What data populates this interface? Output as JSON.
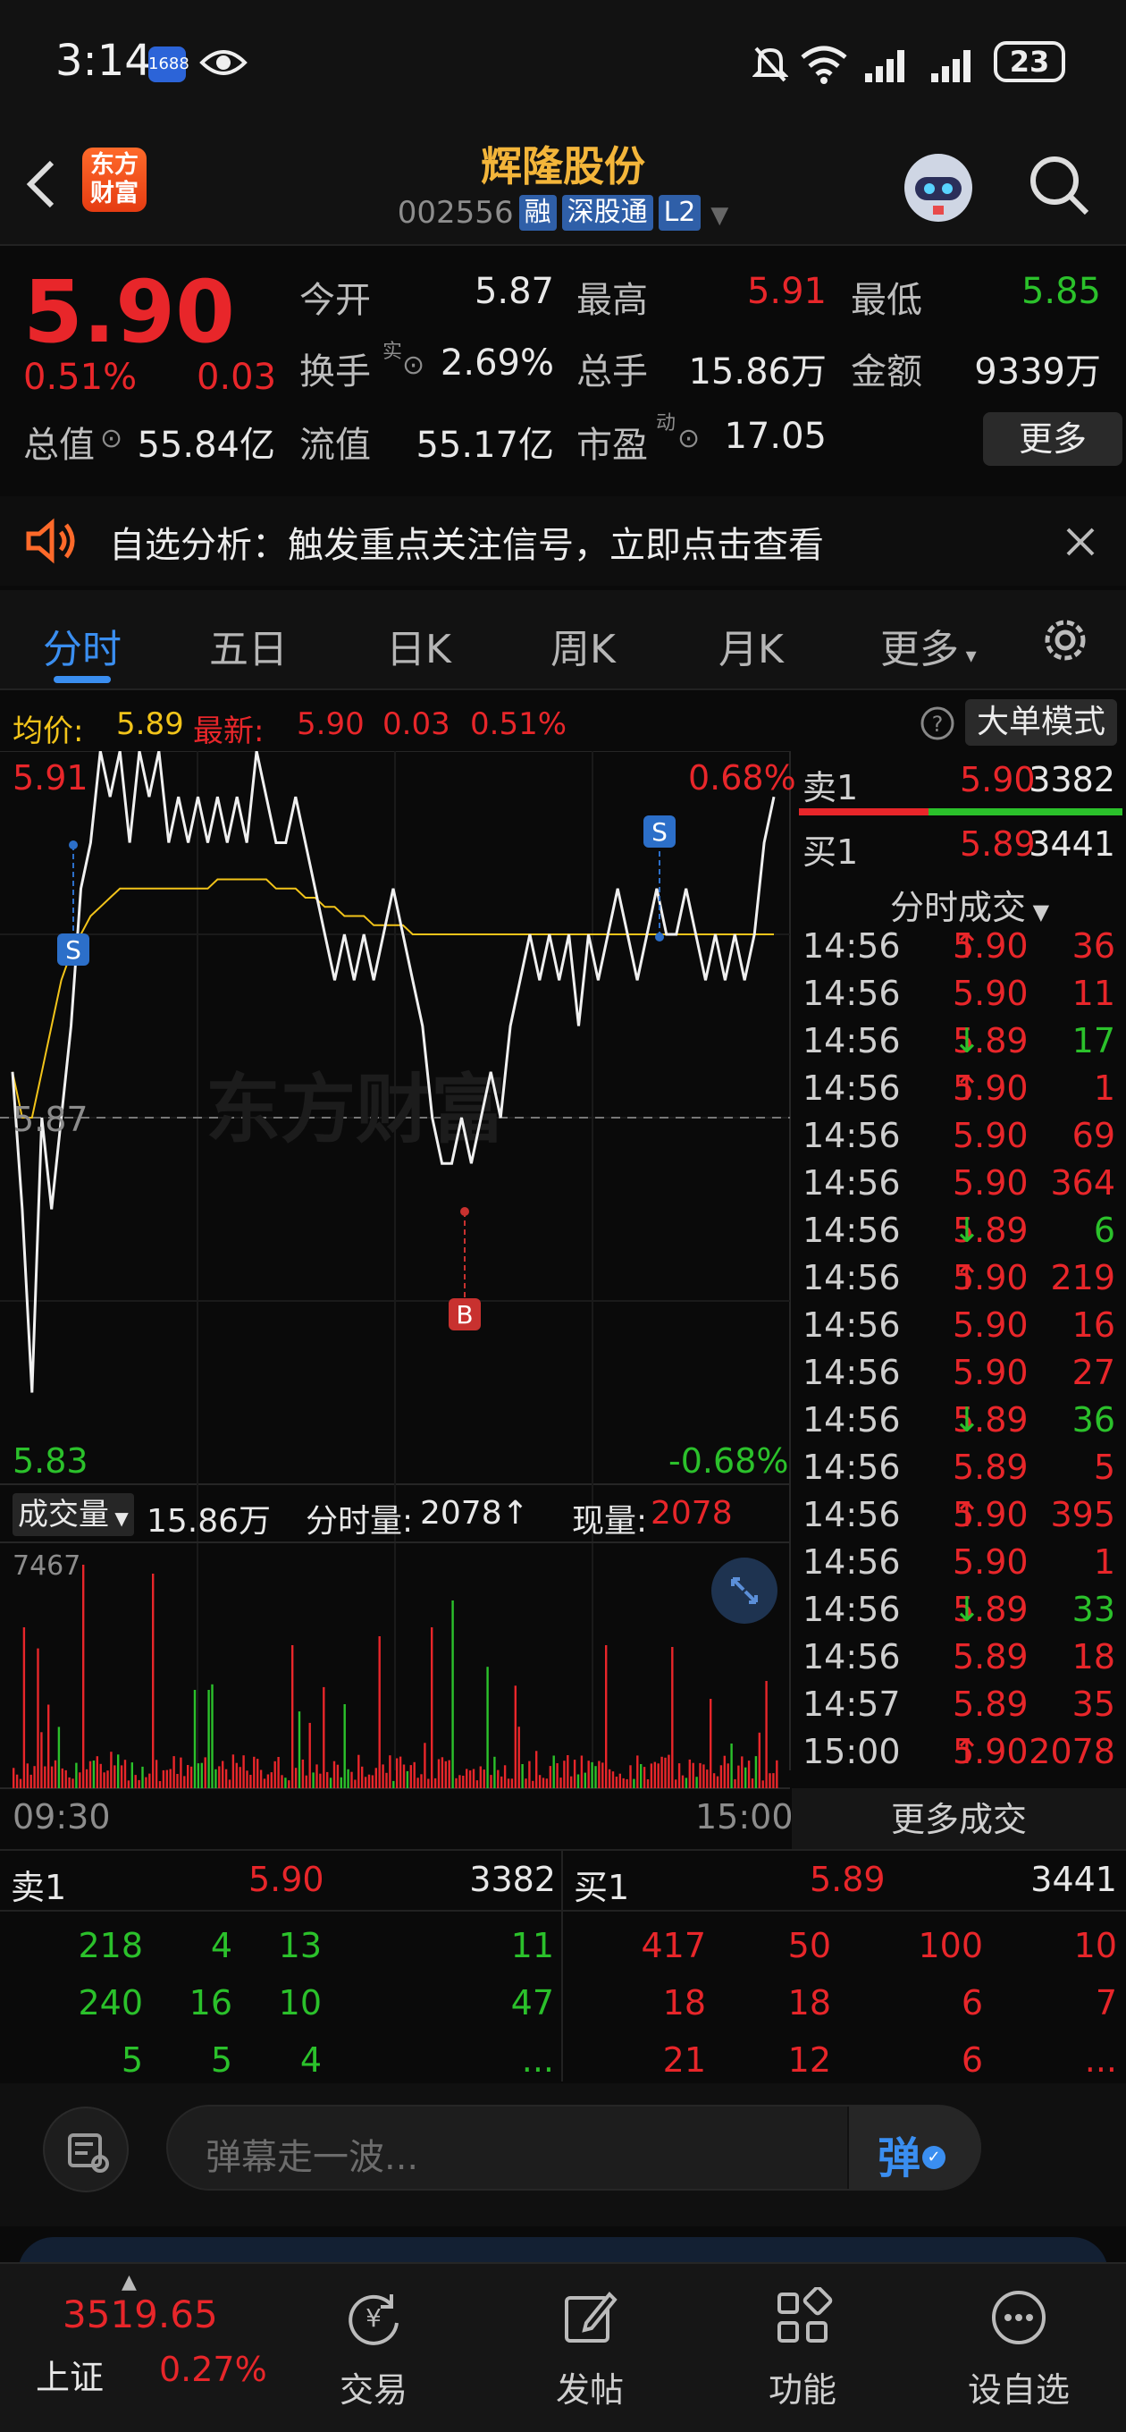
{
  "status_bar": {
    "time": "3:14",
    "app_badge": "1688",
    "battery": "23"
  },
  "header": {
    "logo_line1": "东方",
    "logo_line2": "财富",
    "stock_name": "辉隆股份",
    "stock_code": "002556",
    "tags": [
      "融",
      "深股通",
      "L2"
    ]
  },
  "quote": {
    "price": "5.90",
    "change_pct": "0.51%",
    "change": "0.03",
    "open_label": "今开",
    "open": "5.87",
    "high_label": "最高",
    "high": "5.91",
    "low_label": "最低",
    "low": "5.85",
    "turnover_label": "换手",
    "turnover_sup": "实",
    "turnover": "2.69%",
    "vol_label": "总手",
    "vol": "15.86万",
    "amount_label": "金额",
    "amount": "9339万",
    "mktcap_label": "总值",
    "mktcap": "55.84亿",
    "float_label": "流值",
    "float": "55.17亿",
    "pe_label": "市盈",
    "pe_sup": "动",
    "pe": "17.05",
    "more_label": "更多"
  },
  "alert": {
    "text": "自选分析：触发重点关注信号，立即点击查看"
  },
  "tabs": [
    "分时",
    "五日",
    "日K",
    "周K",
    "月K",
    "更多"
  ],
  "infoline": {
    "avg_label": "均价:",
    "avg": "5.89",
    "latest_label": "最新:",
    "latest": "5.90",
    "latest_change": "0.03",
    "latest_pct": "0.51%",
    "big_order_label": "大单模式"
  },
  "chart_labels": {
    "top_price": "5.91",
    "top_pct": "0.68%",
    "mid_price": "5.87",
    "bottom_price": "5.83",
    "bottom_pct": "-0.68%",
    "marker_s": "S",
    "marker_b": "B",
    "watermark": "东方财富"
  },
  "volume": {
    "label": "成交量",
    "total": "15.86万",
    "minute_label": "分时量:",
    "minute": "2078",
    "current_label": "现量:",
    "current": "2078",
    "max_tick": "7467",
    "time_start": "09:30",
    "time_end": "15:00"
  },
  "tape": {
    "sell1_label": "卖1",
    "sell1_price": "5.90",
    "sell1_vol": "3382",
    "buy1_label": "买1",
    "buy1_price": "5.89",
    "buy1_vol": "3441",
    "title": "分时成交",
    "more_label": "更多成交",
    "rows": [
      {
        "time": "14:56",
        "price": "5.90",
        "arrow": "↑",
        "vol": "36",
        "dir": "up"
      },
      {
        "time": "14:56",
        "price": "5.90",
        "arrow": "",
        "vol": "11",
        "dir": "up"
      },
      {
        "time": "14:56",
        "price": "5.89",
        "arrow": "↓",
        "vol": "17",
        "dir": "down"
      },
      {
        "time": "14:56",
        "price": "5.90",
        "arrow": "↑",
        "vol": "1",
        "dir": "up"
      },
      {
        "time": "14:56",
        "price": "5.90",
        "arrow": "",
        "vol": "69",
        "dir": "up"
      },
      {
        "time": "14:56",
        "price": "5.90",
        "arrow": "",
        "vol": "364",
        "dir": "up"
      },
      {
        "time": "14:56",
        "price": "5.89",
        "arrow": "↓",
        "vol": "6",
        "dir": "down"
      },
      {
        "time": "14:56",
        "price": "5.90",
        "arrow": "↑",
        "vol": "219",
        "dir": "up"
      },
      {
        "time": "14:56",
        "price": "5.90",
        "arrow": "",
        "vol": "16",
        "dir": "up"
      },
      {
        "time": "14:56",
        "price": "5.90",
        "arrow": "",
        "vol": "27",
        "dir": "up"
      },
      {
        "time": "14:56",
        "price": "5.89",
        "arrow": "↓",
        "vol": "36",
        "dir": "down"
      },
      {
        "time": "14:56",
        "price": "5.89",
        "arrow": "",
        "vol": "5",
        "dir": "up"
      },
      {
        "time": "14:56",
        "price": "5.90",
        "arrow": "↑",
        "vol": "395",
        "dir": "up"
      },
      {
        "time": "14:56",
        "price": "5.90",
        "arrow": "",
        "vol": "1",
        "dir": "up"
      },
      {
        "time": "14:56",
        "price": "5.89",
        "arrow": "↓",
        "vol": "33",
        "dir": "down"
      },
      {
        "time": "14:56",
        "price": "5.89",
        "arrow": "",
        "vol": "18",
        "dir": "up"
      },
      {
        "time": "14:57",
        "price": "5.89",
        "arrow": "",
        "vol": "35",
        "dir": "up"
      },
      {
        "time": "15:00",
        "price": "5.90",
        "arrow": "↑",
        "vol": "2078",
        "dir": "up"
      }
    ]
  },
  "order_book": {
    "sell_label": "卖1",
    "sell_price": "5.90",
    "sell_vol": "3382",
    "buy_label": "买1",
    "buy_price": "5.89",
    "buy_vol": "3441",
    "sell_orders": [
      [
        "218",
        "4",
        "13",
        "11"
      ],
      [
        "240",
        "16",
        "10",
        "47"
      ],
      [
        "5",
        "5",
        "4",
        "..."
      ]
    ],
    "buy_orders": [
      [
        "417",
        "50",
        "100",
        "10"
      ],
      [
        "18",
        "18",
        "6",
        "7"
      ],
      [
        "21",
        "12",
        "6",
        "..."
      ]
    ]
  },
  "barrage": {
    "placeholder": "弹幕走一波...",
    "send_label": "弹"
  },
  "bottom_nav": {
    "index_value": "3519.65",
    "index_name": "上证",
    "index_pct": "0.27%",
    "items": [
      "交易",
      "发帖",
      "功能",
      "设自选"
    ]
  },
  "colors": {
    "up": "#e8262a",
    "down": "#2bc12b",
    "avg_line": "#f2c41a",
    "accent": "#3a8ef0"
  },
  "chart_data": {
    "type": "line",
    "title": "",
    "y_range": [
      5.83,
      5.91
    ],
    "prev_close": 5.87,
    "x_range": [
      "09:30",
      "15:00"
    ],
    "series": [
      {
        "name": "",
        "values": [
          5.875,
          5.86,
          5.84,
          5.87,
          5.86,
          5.87,
          5.88,
          5.895,
          5.9,
          5.91,
          5.905,
          5.91,
          5.9,
          5.91,
          5.905,
          5.91,
          5.9,
          5.905,
          5.9,
          5.905,
          5.9,
          5.905,
          5.9,
          5.905,
          5.9,
          5.91,
          5.905,
          5.9,
          5.9,
          5.905,
          5.9,
          5.895,
          5.89,
          5.885,
          5.89,
          5.885,
          5.89,
          5.885,
          5.89,
          5.895,
          5.89,
          5.885,
          5.88,
          5.87,
          5.865,
          5.865,
          5.87,
          5.865,
          5.87,
          5.875,
          5.87,
          5.88,
          5.885,
          5.89,
          5.885,
          5.89,
          5.885,
          5.89,
          5.88,
          5.89,
          5.885,
          5.89,
          5.895,
          5.89,
          5.885,
          5.89,
          5.895,
          5.89,
          5.89,
          5.895,
          5.89,
          5.885,
          5.89,
          5.885,
          5.89,
          5.885,
          5.89,
          5.9,
          5.905
        ]
      },
      {
        "name": "",
        "values": [
          5.875,
          5.87,
          5.87,
          5.875,
          5.88,
          5.885,
          5.888,
          5.89,
          5.892,
          5.893,
          5.894,
          5.895,
          5.895,
          5.895,
          5.895,
          5.895,
          5.895,
          5.895,
          5.895,
          5.895,
          5.895,
          5.896,
          5.896,
          5.896,
          5.896,
          5.896,
          5.896,
          5.895,
          5.895,
          5.895,
          5.894,
          5.894,
          5.893,
          5.893,
          5.892,
          5.892,
          5.892,
          5.891,
          5.891,
          5.891,
          5.891,
          5.89,
          5.89,
          5.89,
          5.89,
          5.89,
          5.89,
          5.89,
          5.89,
          5.89,
          5.89,
          5.89,
          5.89,
          5.89,
          5.89,
          5.89,
          5.89,
          5.89,
          5.89,
          5.89,
          5.89,
          5.89,
          5.89,
          5.89,
          5.89,
          5.89,
          5.89,
          5.89,
          5.89,
          5.89,
          5.89,
          5.89,
          5.89,
          5.89,
          5.89,
          5.89,
          5.89,
          5.89,
          5.89
        ]
      }
    ]
  }
}
